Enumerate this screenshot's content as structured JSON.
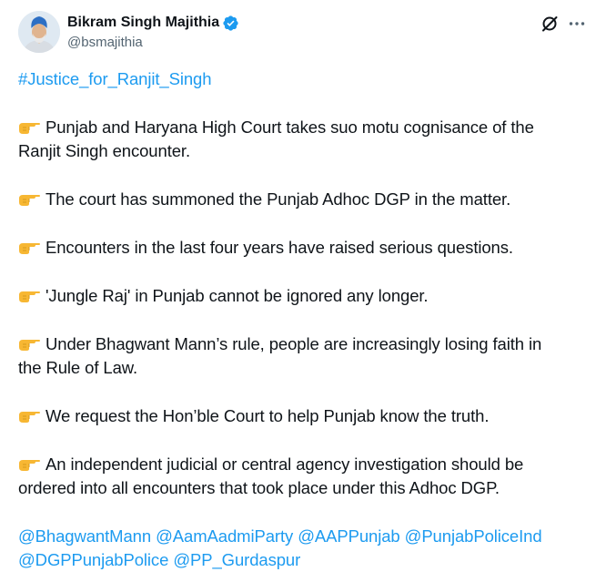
{
  "author": {
    "display_name": "Bikram Singh Majithia",
    "handle": "@bsmajithia",
    "verified": true
  },
  "colors": {
    "link": "#1d9bf0",
    "verified_badge": "#1d9bf0",
    "text": "#0f1419",
    "secondary": "#536471"
  },
  "icons": [
    "grok-icon",
    "more-icon",
    "verified-badge-icon",
    "pointing-hand-emoji-icon"
  ],
  "hashtag": "#Justice_for_Ranjit_Singh",
  "points": [
    [
      "Punjab and Haryana High Court takes suo motu cognisance of the",
      "Ranjit Singh encounter."
    ],
    [
      "The court has summoned the Punjab Adhoc DGP in the matter."
    ],
    [
      "Encounters in the last four years have raised serious questions."
    ],
    [
      "'Jungle Raj' in Punjab cannot be ignored any longer."
    ],
    [
      "Under Bhagwant Mann’s rule, people are increasingly losing faith in",
      "the Rule of Law."
    ],
    [
      "We request the Hon’ble Court to help Punjab know the truth."
    ],
    [
      "An independent judicial or central agency investigation should be",
      "ordered into all encounters that took place under this Adhoc DGP."
    ]
  ],
  "mentions": [
    [
      "@BhagwantMann",
      "@AamAadmiParty",
      "@AAPPunjab",
      "@PunjabPoliceInd"
    ],
    [
      "@DGPPunjabPolice",
      "@PP_Gurdaspur"
    ]
  ]
}
